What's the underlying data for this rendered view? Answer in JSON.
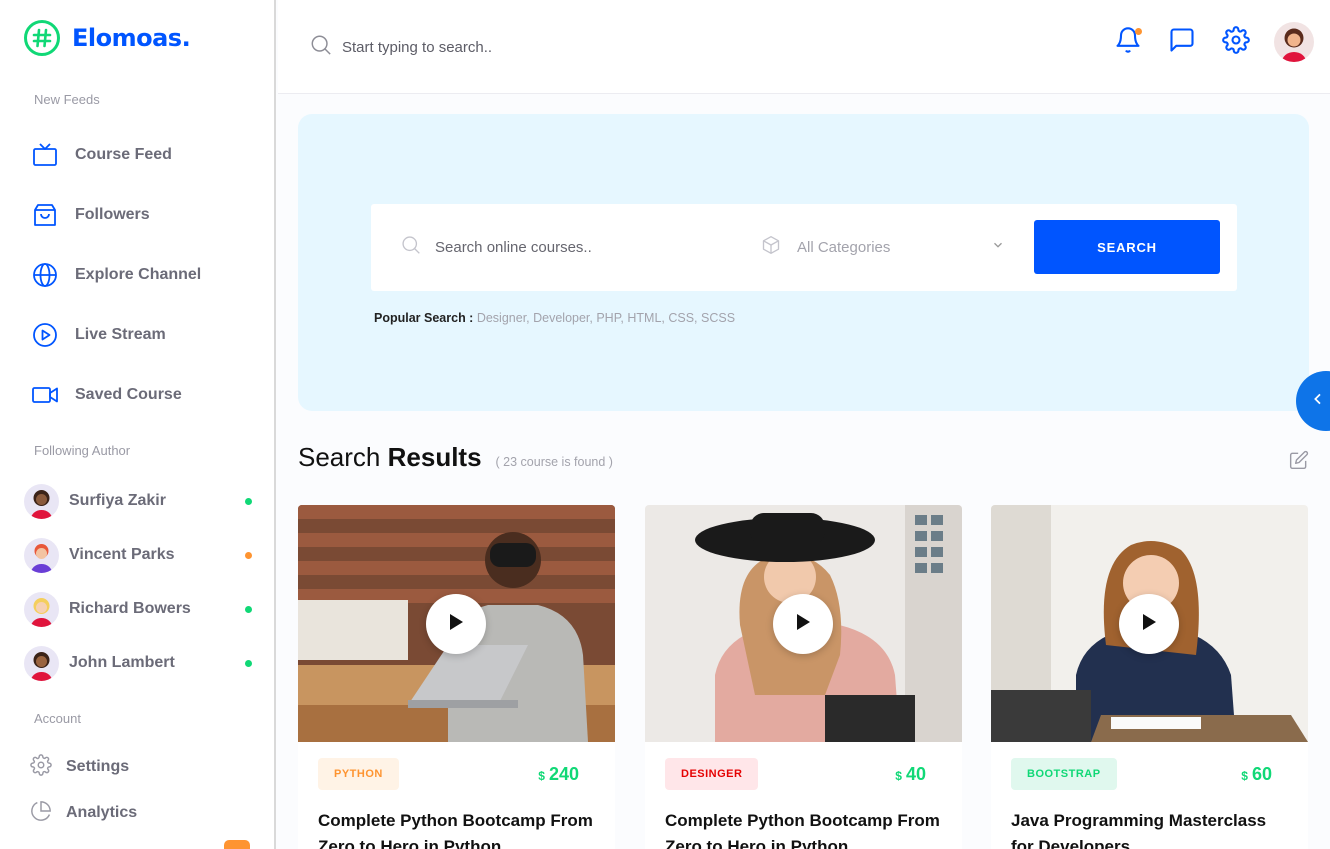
{
  "brand": {
    "name": "Elomoas.",
    "color": "#0055ff",
    "mark_color": "#10d876"
  },
  "sidebar": {
    "feeds_label": "New Feeds",
    "feeds": [
      {
        "label": "Course Feed",
        "icon": "tv-icon"
      },
      {
        "label": "Followers",
        "icon": "shopping-bag-icon"
      },
      {
        "label": "Explore Channel",
        "icon": "globe-icon"
      },
      {
        "label": "Live Stream",
        "icon": "play-circle-icon"
      },
      {
        "label": "Saved Course",
        "icon": "video-icon"
      }
    ],
    "authors_label": "Following Author",
    "authors": [
      {
        "name": "Surfiya Zakir",
        "status_color": "#10d876"
      },
      {
        "name": "Vincent Parks",
        "status_color": "#fe9431"
      },
      {
        "name": "Richard Bowers",
        "status_color": "#10d876"
      },
      {
        "name": "John Lambert",
        "status_color": "#10d876"
      }
    ],
    "account_label": "Account",
    "account": [
      {
        "label": "Settings",
        "icon": "gear-icon"
      },
      {
        "label": "Analytics",
        "icon": "pie-chart-icon"
      }
    ]
  },
  "header": {
    "search_placeholder": "Start typing to search..",
    "icons": [
      "bell-icon",
      "message-icon",
      "gear-icon",
      "user-avatar"
    ]
  },
  "hero": {
    "search_placeholder": "Search online courses..",
    "category_value": "All Categories",
    "search_button": "SEARCH",
    "popular_label": "Popular Search :",
    "popular_tags": "Designer, Developer, PHP, HTML, CSS, SCSS"
  },
  "results": {
    "title_light": "Search",
    "title_bold": "Results",
    "count_text": "( 23 course is found )"
  },
  "cards": [
    {
      "tag": "PYTHON",
      "tag_bg": "#fff3e6",
      "tag_color": "#fe9431",
      "currency": "$",
      "price": "240",
      "title": "Complete Python Bootcamp From Zero to Hero in Python"
    },
    {
      "tag": "DESINGER",
      "tag_bg": "#ffe6e9",
      "tag_color": "#e50202",
      "currency": "$",
      "price": "40",
      "title": "Complete Python Bootcamp From Zero to Hero in Python"
    },
    {
      "tag": "BOOTSTRAP",
      "tag_bg": "#e0f8ee",
      "tag_color": "#10d876",
      "currency": "$",
      "price": "60",
      "title": "Java Programming Masterclass for Developers"
    }
  ]
}
